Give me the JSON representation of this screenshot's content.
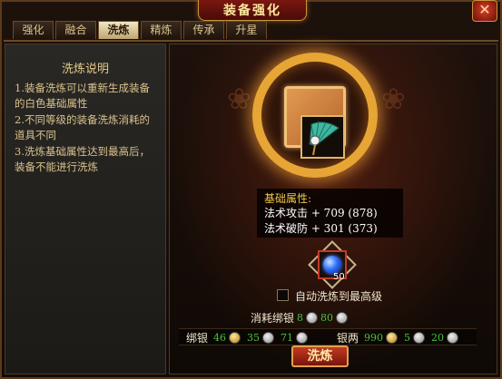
{
  "window": {
    "title": "装备强化",
    "close_symbol": "✕"
  },
  "tabs": [
    {
      "label": "强化",
      "active": false
    },
    {
      "label": "融合",
      "active": false
    },
    {
      "label": "洗炼",
      "active": true
    },
    {
      "label": "精炼",
      "active": false
    },
    {
      "label": "传承",
      "active": false
    },
    {
      "label": "升星",
      "active": false
    }
  ],
  "info_panel": {
    "title": "洗炼说明",
    "items": [
      "1.装备洗炼可以重新生成装备的白色基础属性",
      "2.不同等级的装备洗炼消耗的道具不同",
      "3.洗炼基础属性达到最高后，装备不能进行洗炼"
    ]
  },
  "equipment": {
    "icon": "jade-fan-icon"
  },
  "stats": {
    "heading": "基础属性:",
    "lines": [
      "法术攻击 + 709 (878)",
      "法术破防 + 301 (373)"
    ]
  },
  "material": {
    "icon": "blue-orb-icon",
    "count": "50"
  },
  "auto_refine": {
    "label": "自动洗炼到最高级",
    "checked": false
  },
  "cost": {
    "label": "消耗绑银",
    "values": [
      "8",
      "80"
    ]
  },
  "money": {
    "bound_label": "绑银",
    "bound_values": [
      "46",
      "35",
      "71"
    ],
    "silver_label": "银两",
    "silver_values": [
      "990",
      "5",
      "20"
    ]
  },
  "action_button": {
    "label": "洗炼"
  },
  "colors": {
    "accent_gold": "#e6a535",
    "value_green": "#49c23c",
    "stat_heading": "#f0c84a",
    "button_red": "#c03a20"
  }
}
